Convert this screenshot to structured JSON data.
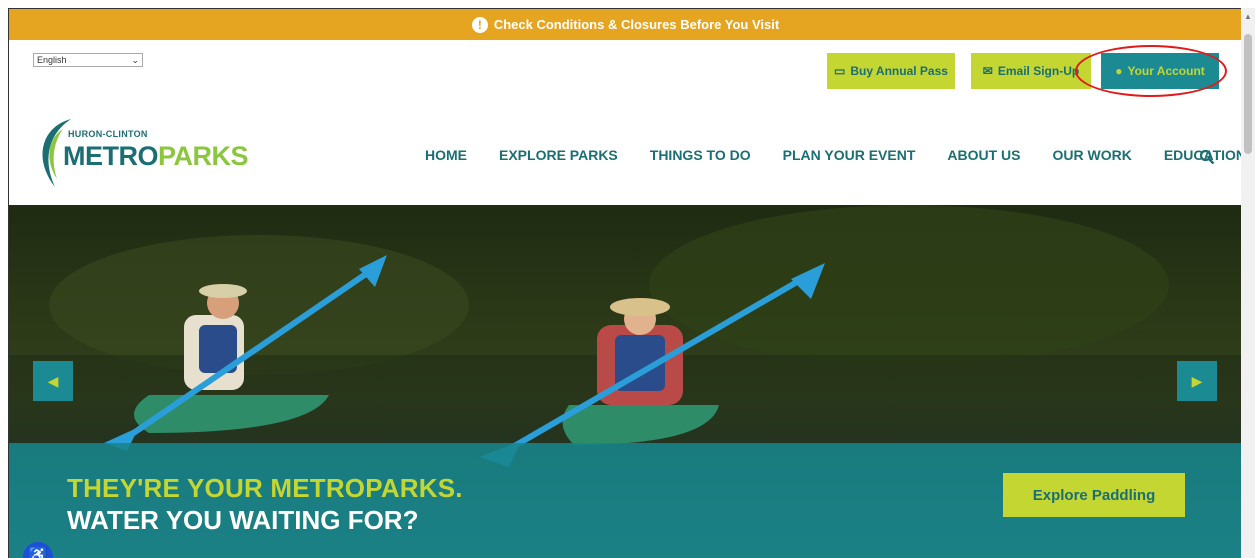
{
  "alert": {
    "text": "Check Conditions & Closures Before You Visit",
    "icon": "alert-icon"
  },
  "language": {
    "selected": "English"
  },
  "top_buttons": {
    "annual_pass": "Buy Annual Pass",
    "email_signup": "Email Sign-Up",
    "account": "Your Account"
  },
  "logo": {
    "small": "HURON-CLINTON",
    "metro": "METRO",
    "parks": "PARKS"
  },
  "nav": {
    "items": [
      "HOME",
      "EXPLORE PARKS",
      "THINGS TO DO",
      "PLAN YOUR EVENT",
      "ABOUT US",
      "OUR WORK",
      "EDUCATION"
    ]
  },
  "hero": {
    "line1": "THEY'RE YOUR METROPARKS.",
    "line2": "WATER YOU WAITING FOR?",
    "cta": "Explore Paddling"
  },
  "colors": {
    "alert": "#e6a520",
    "brand_teal": "#1b6e73",
    "brand_lime": "#c3d631",
    "annotation": "#e01b1b"
  }
}
